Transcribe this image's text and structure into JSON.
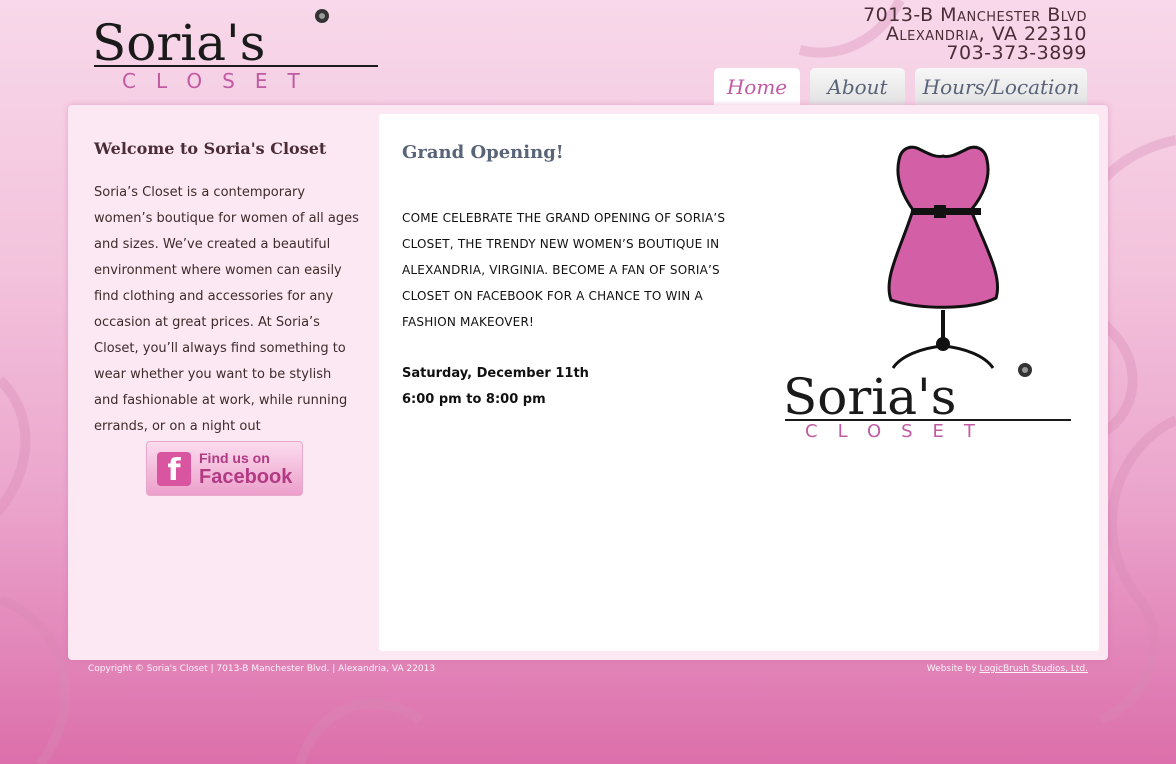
{
  "logo": {
    "name": "Soria's",
    "sub": "CLOSET"
  },
  "address": {
    "line1": "7013-B Manchester Blvd",
    "line2": "Alexandria, VA 22310",
    "phone": "703-373-3899"
  },
  "tabs": [
    {
      "label": "Home",
      "active": true
    },
    {
      "label": "About",
      "active": false
    },
    {
      "label": "Hours/Location",
      "active": false
    }
  ],
  "sidebar": {
    "heading": "Welcome to Soria's Closet",
    "body": "Soria’s Closet is a contemporary women’s boutique for women of all ages and sizes. We’ve created a beautiful environment where women can easily find clothing and accessories for any occasion at great prices. At Soria’s Closet, you’ll always find something to wear whether you want to be stylish and fashionable at work, while running errands, or on a night out",
    "facebook": {
      "line1": "Find us on",
      "line2": "Facebook"
    }
  },
  "main": {
    "heading": "Grand Opening!",
    "announcement": "Come celebrate the grand opening of Soria’s Closet, the trendy new women’s boutique in Alexandria, Virginia. Become a fan of Soria’s Closet on Facebook for a chance to win a fashion makeover!",
    "date": "Saturday, December 11th",
    "time": "6:00 pm to 8:00 pm"
  },
  "footer": {
    "copyright": "Copyright © Soria's Closet | 7013-B Manchester Blvd. | Alexandria, VA 22013",
    "credit_prefix": "Website by ",
    "credit_link": "LogicBrush Studios, Ltd."
  },
  "colors": {
    "accent": "#c05aa3",
    "dress": "#d35fa7",
    "heading": "#5a6479"
  }
}
